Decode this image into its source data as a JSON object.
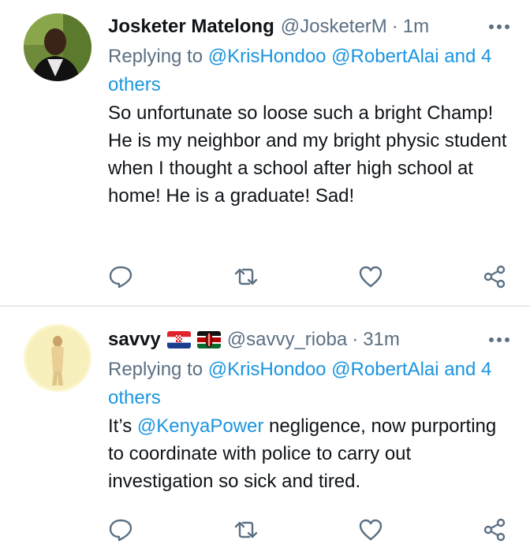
{
  "tweets": [
    {
      "name": "Josketer Matelong",
      "handle": "@JosketerM",
      "separator": "·",
      "time": "1m",
      "reply_prefix": "Replying to",
      "reply_mentions": "@KrisHondoo @RobertAlai and",
      "reply_others": "4 others",
      "body": "So unfortunate so loose such a bright Champ! He is my neighbor and my bright physic student when I thought a school after high school at home! He is a graduate! Sad!"
    },
    {
      "name": "savvy",
      "flags": [
        "croatia-flag",
        "kenya-flag"
      ],
      "handle": "@savvy_rioba",
      "separator": "·",
      "time": "31m",
      "reply_prefix": "Replying to",
      "reply_mentions": "@KrisHondoo @RobertAlai and",
      "reply_others": "4 others",
      "body_before": "It’s ",
      "body_mention": "@KenyaPower",
      "body_after": " negligence, now purporting to coordinate with police to carry out investigation so sick and tired."
    }
  ],
  "icons": [
    "more-icon",
    "reply-icon",
    "retweet-icon",
    "like-icon",
    "share-icon"
  ],
  "colors": {
    "link": "#1b95e0",
    "secondary": "#5b7083",
    "divider": "#e6ecf0"
  }
}
